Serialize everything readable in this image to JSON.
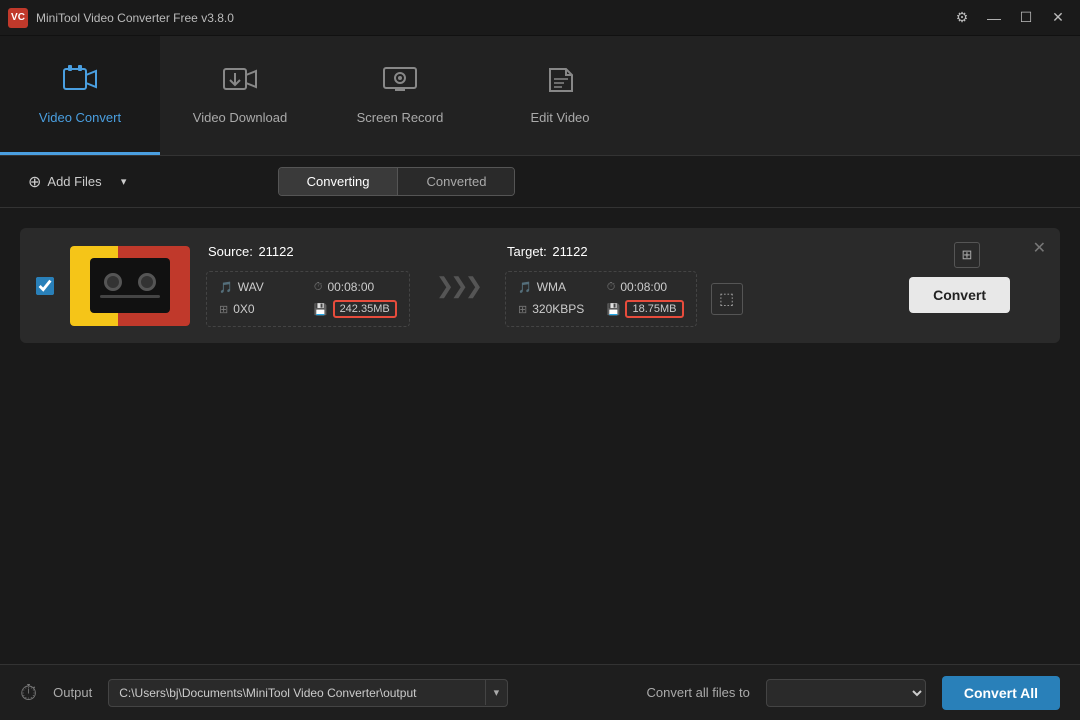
{
  "app": {
    "title": "MiniTool Video Converter Free v3.8.0",
    "logo_text": "VC"
  },
  "window_controls": {
    "settings_label": "⚙",
    "minimize_label": "—",
    "maximize_label": "☐",
    "close_label": "✕"
  },
  "nav": {
    "items": [
      {
        "id": "video-convert",
        "label": "Video Convert",
        "active": true
      },
      {
        "id": "video-download",
        "label": "Video Download",
        "active": false
      },
      {
        "id": "screen-record",
        "label": "Screen Record",
        "active": false
      },
      {
        "id": "edit-video",
        "label": "Edit Video",
        "active": false
      }
    ]
  },
  "toolbar": {
    "add_files_label": "Add Files",
    "tabs": [
      {
        "id": "converting",
        "label": "Converting",
        "active": true
      },
      {
        "id": "converted",
        "label": "Converted",
        "active": false
      }
    ]
  },
  "file_card": {
    "source_label": "Source:",
    "source_name": "21122",
    "target_label": "Target:",
    "target_name": "21122",
    "source_format": "WAV",
    "source_duration": "00:08:00",
    "source_resolution": "0X0",
    "source_size": "242.35MB",
    "target_format": "WMA",
    "target_duration": "00:08:00",
    "target_bitrate": "320KBPS",
    "target_size": "18.75MB",
    "convert_btn_label": "Convert"
  },
  "bottom_bar": {
    "clock_icon": "⏱",
    "output_label": "Output",
    "output_path": "C:\\Users\\bj\\Documents\\MiniTool Video Converter\\output",
    "convert_all_files_label": "Convert all files to",
    "convert_all_btn_label": "Convert All"
  }
}
